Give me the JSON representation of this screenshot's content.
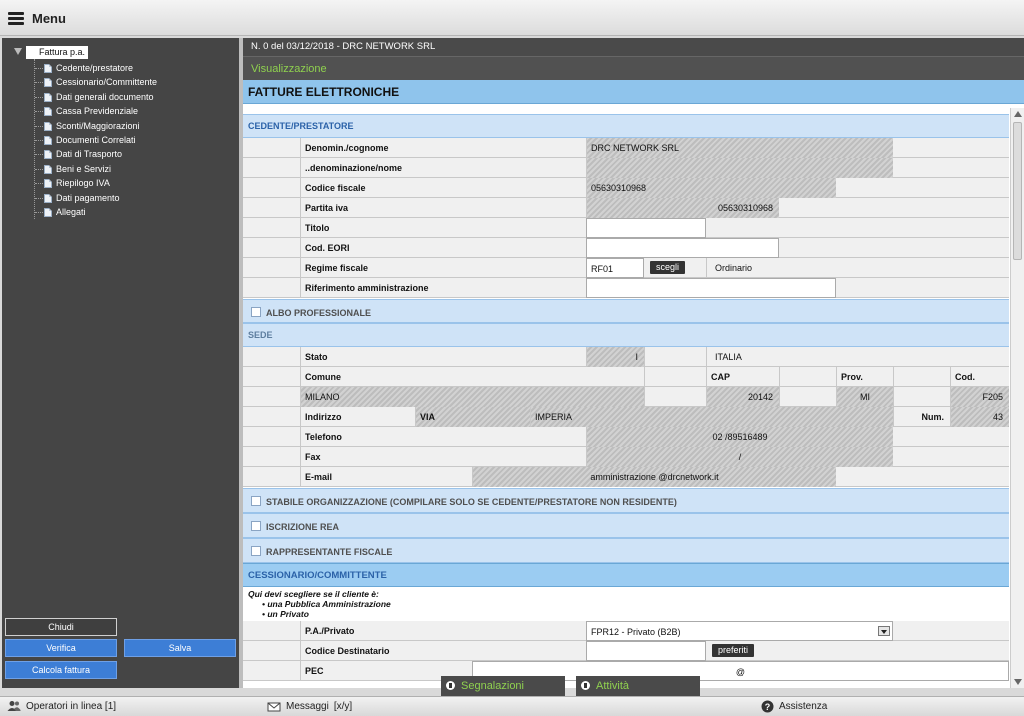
{
  "topbar": {
    "menu_label": "Menu"
  },
  "tree": {
    "root": "Fattura p.a.",
    "items": [
      "Cedente/prestatore",
      "Cessionario/Committente",
      "Dati generali documento",
      "Cassa Previdenziale",
      "Sconti/Maggiorazioni",
      "Documenti Correlati",
      "Dati di Trasporto",
      "Beni e Servizi",
      "Riepilogo IVA",
      "Dati pagamento",
      "Allegati"
    ]
  },
  "left_buttons": {
    "chiudi": "Chiudi",
    "verifica": "Verifica",
    "salva": "Salva",
    "calcola": "Calcola fattura"
  },
  "header": {
    "doc_title": "N. 0 del 03/12/2018 - DRC NETWORK SRL",
    "mode": "Visualizzazione",
    "section": "FATTURE ELETTRONICHE"
  },
  "cedente": {
    "title": "CEDENTE/PRESTATORE",
    "denominazione_label": "Denomin./cognome",
    "denominazione": "DRC NETWORK SRL",
    "nome_label": "..denominazione/nome",
    "codice_fiscale_label": "Codice fiscale",
    "codice_fiscale": "05630310968",
    "partita_iva_label": "Partita iva",
    "partita_iva": "05630310968",
    "titolo_label": "Titolo",
    "eori_label": "Cod. EORI",
    "regime_label": "Regime fiscale",
    "regime_code": "RF01",
    "regime_button": "scegli",
    "regime_desc": "Ordinario",
    "rif_amm_label": "Riferimento amministrazione"
  },
  "albo": {
    "label": "ALBO PROFESSIONALE"
  },
  "sede": {
    "title": "SEDE",
    "stato_label": "Stato",
    "stato_code": "I",
    "stato_name": "ITALIA",
    "comune_label": "Comune",
    "cap_label": "CAP",
    "prov_label": "Prov.",
    "cod_label": "Cod.",
    "comune": "MILANO",
    "cap": "20142",
    "prov": "MI",
    "cod": "F205",
    "indirizzo_label": "Indirizzo",
    "via_type": "VIA",
    "via_name": "IMPERIA",
    "num_label": "Num.",
    "num": "43",
    "telefono_label": "Telefono",
    "telefono": "02 /89516489",
    "fax_label": "Fax",
    "fax": "/",
    "email_label": "E-mail",
    "email": "amministrazione @drcnetwork.it"
  },
  "extra_sections": {
    "stabile": "STABILE ORGANIZZAZIONE (COMPILARE SOLO SE CEDENTE/PRESTATORE NON RESIDENTE)",
    "rea": "ISCRIZIONE REA",
    "rappresentante": "RAPPRESENTANTE FISCALE"
  },
  "cessionario": {
    "title": "CESSIONARIO/COMMITTENTE",
    "note_line1": "Qui devi scegliere se il cliente è:",
    "note_line2": "• una Pubblica Amministrazione",
    "note_line3": "• un Privato",
    "pa_label": "P.A./Privato",
    "pa_value": "FPR12 - Privato (B2B)",
    "codice_dest_label": "Codice Destinatario",
    "preferiti_button": "preferiti",
    "pec_label": "PEC",
    "pec_value": "@"
  },
  "tabs": {
    "segnalazioni": "Segnalazioni",
    "attivita": "Attività"
  },
  "bottom": {
    "operatori": "Operatori in linea [1]",
    "messaggi": "Messaggi",
    "messaggi_counts": "[x/y]",
    "assistenza": "Assistenza"
  }
}
